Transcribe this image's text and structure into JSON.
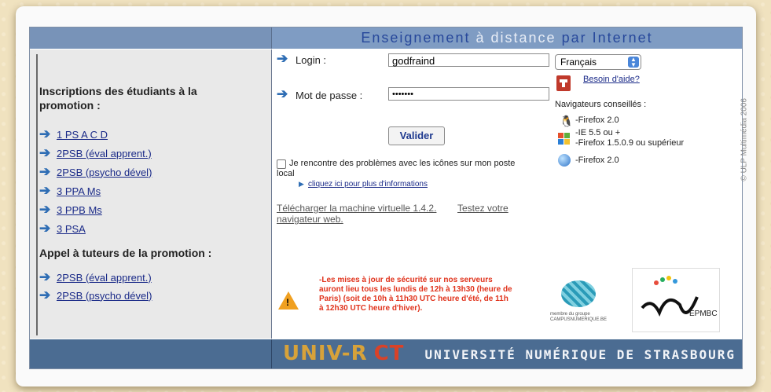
{
  "header": {
    "title_part1": "Enseignement",
    "title_part2": "à",
    "title_part3": "distance",
    "title_part4": "par Internet"
  },
  "left": {
    "section1_title": "Inscriptions des étudiants à la promotion :",
    "section1_title_line1": "Inscriptions des étudiants à la",
    "section1_title_line2": "promotion :",
    "promotions": [
      "1 PS A C D",
      "2PSB (éval apprent.)",
      "2PSB (psycho dével)",
      "3 PPA Ms",
      "3 PPB Ms",
      "3 PSA"
    ],
    "section2_title": "Appel à tuteurs de la promotion :",
    "tutors": [
      "2PSB (éval apprent.)",
      "2PSB (psycho dével)"
    ]
  },
  "login": {
    "login_label": "Login :",
    "login_value": "godfraind",
    "password_label": "Mot de passe :",
    "password_value": "•••••••",
    "submit_label": "Valider",
    "icons_problem": "Je rencontre des problèmes avec les icônes sur mon poste local",
    "icons_problem_line1": "Je rencontre des problèmes avec les icônes sur mon poste",
    "icons_problem_line2": "local",
    "more_info": "cliquez ici pour plus d'informations",
    "download_vm": "Télécharger la machine virtuelle 1.4.2.",
    "test_browser": "Testez votre navigateur web."
  },
  "sidebar": {
    "language_selected": "Français",
    "help_link": "Besoin d'aide?",
    "browsers_title": "Navigateurs conseillés :",
    "browsers": [
      "-Firefox 2.0",
      "-IE 5.5 ou +",
      "-Firefox 1.5.0.9 ou supérieur",
      "-Firefox 2.0"
    ],
    "copyright": "© ULP Multimédia 2006"
  },
  "notice": {
    "line1": "-Les mises à jour de sécurité sur nos serveurs",
    "line2": "auront lieu tous les lundis de 12h à 13h30 (heure de",
    "line3": "Paris) (soit de 10h à 11h30 UTC heure d'été, de 11h",
    "line4": "à 12h30 UTC heure d'hiver)."
  },
  "logos": {
    "campus_caption": "membre du groupe CAMPUSNUMERIQUE.BE",
    "epmbc_text": "EPMBC"
  },
  "footer": {
    "brand_part1": "UNIV-R",
    "brand_part2": "CT",
    "university": "UNIVERSITÉ NUMÉRIQUE DE STRASBOURG"
  },
  "colors": {
    "header_blue": "#7f9cc3",
    "footer_blue": "#4b6c92",
    "warning_red": "#e0321b",
    "link_blue": "#1a2a88"
  }
}
